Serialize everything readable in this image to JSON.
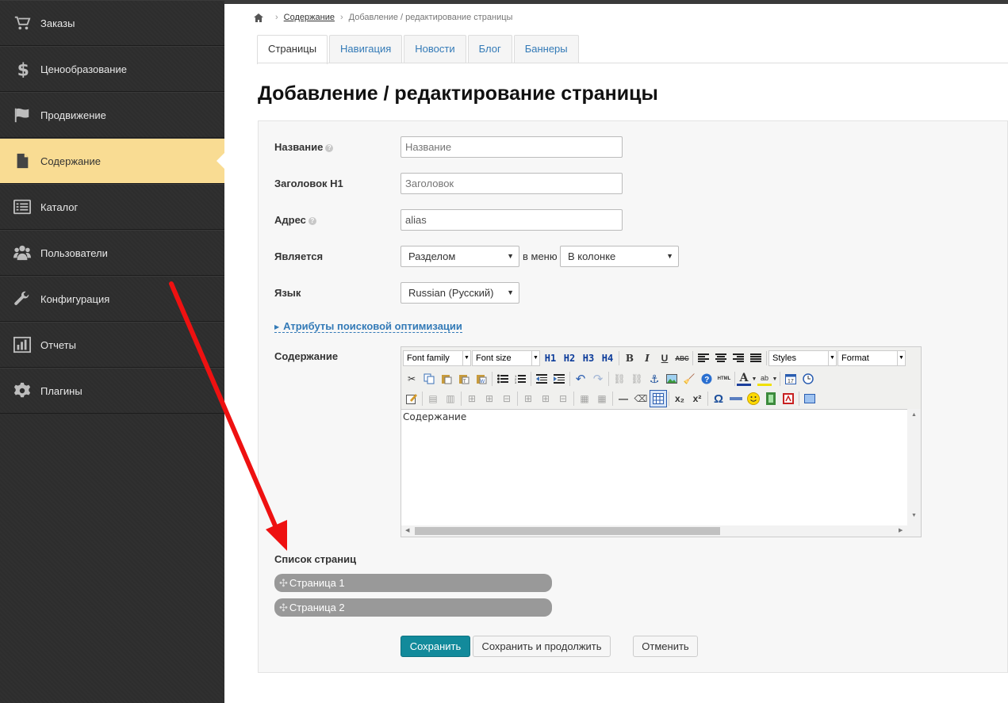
{
  "sidebar": {
    "items": [
      {
        "label": "Заказы",
        "icon": "cart-icon"
      },
      {
        "label": "Ценообразование",
        "icon": "dollar-icon"
      },
      {
        "label": "Продвижение",
        "icon": "flag-icon"
      },
      {
        "label": "Содержание",
        "icon": "file-icon",
        "active": true
      },
      {
        "label": "Каталог",
        "icon": "list-icon"
      },
      {
        "label": "Пользователи",
        "icon": "users-icon"
      },
      {
        "label": "Конфигурация",
        "icon": "wrench-icon"
      },
      {
        "label": "Отчеты",
        "icon": "bar-chart-icon"
      },
      {
        "label": "Плагины",
        "icon": "gear-icon"
      }
    ],
    "active_color": "#f9dc93"
  },
  "breadcrumb": {
    "home_icon": "home-icon",
    "section": "Содержание",
    "current": "Добавление / редактирование страницы"
  },
  "tabs": [
    "Страницы",
    "Навигация",
    "Новости",
    "Блог",
    "Баннеры"
  ],
  "page": {
    "title": "Добавление / редактирование страницы"
  },
  "form": {
    "name_label": "Название",
    "name_placeholder": "Название",
    "h1_label": "Заголовок H1",
    "h1_placeholder": "Заголовок",
    "address_label": "Адрес",
    "address_value": "alias",
    "is_label": "Является",
    "is_value": "Разделом",
    "in_menu_text": "в меню",
    "menu_value": "В колонке",
    "lang_label": "Язык",
    "lang_value": "Russian (Русский)",
    "seo_link": "Атрибуты поисковой оптимизации",
    "content_label": "Содержание",
    "content_text": "Содержание",
    "page_list_label": "Список страниц",
    "pages": [
      "Страница 1",
      "Страница 2"
    ]
  },
  "editor": {
    "font_family": "Font family",
    "font_size": "Font size",
    "h1": "H1",
    "h2": "H2",
    "h3": "H3",
    "h4": "H4",
    "styles": "Styles",
    "format": "Format",
    "bold": "B",
    "italic": "I",
    "underline": "U",
    "strike": "ABC",
    "html": "HTML",
    "omega": "Ω"
  },
  "buttons": {
    "save": "Сохранить",
    "save_continue": "Сохранить и продолжить",
    "cancel": "Отменить"
  },
  "colors": {
    "primary_button": "#128a9b",
    "annotation_arrow": "#ee1111",
    "link": "#337ab7"
  }
}
